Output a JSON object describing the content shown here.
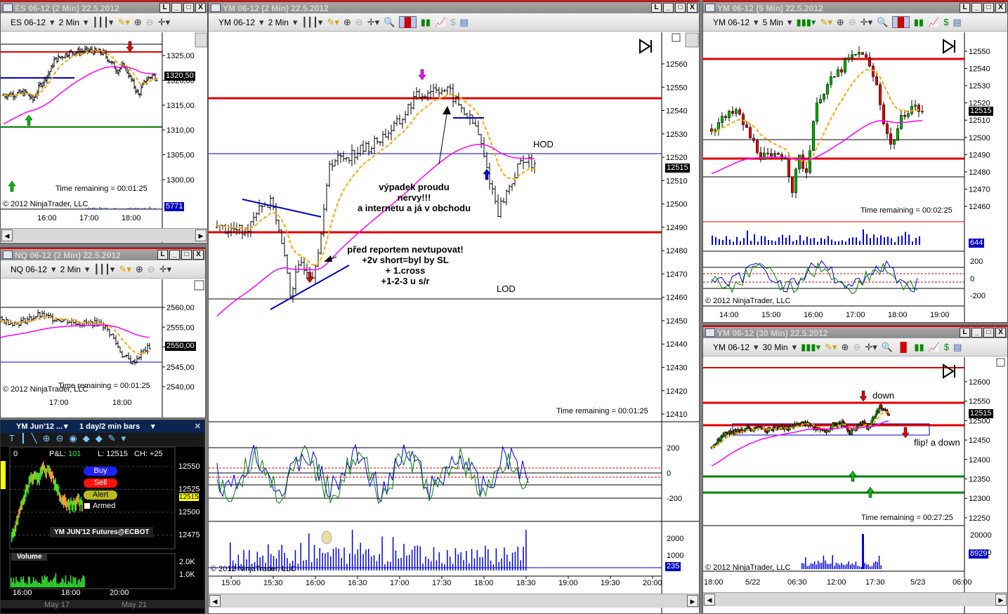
{
  "es": {
    "title": "ES 06-12 (2 Min)  22.5.2012",
    "instrument": "ES 06-12",
    "interval": "2 Min",
    "prices": [
      "1325,00",
      "1320,00",
      "1315,00",
      "1310,00",
      "1305,00",
      "1300,00"
    ],
    "last": "1320,50",
    "time_remaining": "Time remaining = 00:01:25",
    "copyright": "© 2012 NinjaTrader, LLC",
    "volume_badge": "5771",
    "times": [
      "16:00",
      "17:00",
      "18:00"
    ],
    "bars": [
      [
        "14:58",
        1317
      ],
      [
        "15:30",
        1317.5
      ],
      [
        "15:40",
        1316
      ],
      [
        "15:50",
        1319
      ],
      [
        "16:05",
        1322
      ],
      [
        "16:10",
        1324
      ],
      [
        "16:30",
        1325.5
      ],
      [
        "17:00",
        1326
      ],
      [
        "17:20",
        1325.5
      ],
      [
        "17:40",
        1322
      ],
      [
        "17:50",
        1323
      ],
      [
        "18:00",
        1320
      ],
      [
        "18:10",
        1317
      ],
      [
        "18:20",
        1320
      ],
      [
        "18:30",
        1321
      ],
      [
        "18:36",
        1320.5
      ]
    ]
  },
  "nq": {
    "title": "NQ 06-12 (2 Min)  22.5.2012",
    "instrument": "NQ 06-12",
    "interval": "2 Min",
    "prices": [
      "2560,00",
      "2555,00",
      "2550,00",
      "2545,00",
      "2540,00"
    ],
    "last": "2550,00",
    "time_remaining": "Time remaining = 00:01:25",
    "copyright": "© 2012 NinjaTrader, LLC",
    "times": [
      "17:00",
      "18:00"
    ],
    "bars": [
      [
        "15:38",
        2555
      ],
      [
        "16:00",
        2557
      ],
      [
        "16:20",
        2556
      ],
      [
        "16:40",
        2558
      ],
      [
        "17:00",
        2557
      ],
      [
        "17:20",
        2556
      ],
      [
        "17:40",
        2556
      ],
      [
        "17:50",
        2553
      ],
      [
        "18:00",
        2548
      ],
      [
        "18:10",
        2546
      ],
      [
        "18:20",
        2549
      ],
      [
        "18:26",
        2550
      ]
    ]
  },
  "ib": {
    "symbol": "YM Jun'12 ...",
    "period": "1 day/2 min bars",
    "zero": "0",
    "pnl_label": "P&L:",
    "pnl": "101",
    "last": "L: 12515",
    "change": "CH: +25",
    "buy": "Buy",
    "sell": "Sell",
    "alert": "Alert",
    "armed": "Armed",
    "contract": "YM JUN'12 Futures@ECBOT",
    "prices": [
      "12550",
      "12525",
      "12500",
      "12475"
    ],
    "last_badge": "12515",
    "volume": "Volume",
    "vol_ticks": [
      "2.0K",
      "1.0K"
    ],
    "times": [
      "16:00",
      "18:00",
      "20:00"
    ],
    "dates": [
      "May 17",
      "May 21"
    ]
  },
  "main": {
    "title": "YM 06-12 (2 Min)  22.5.2012",
    "instrument": "YM 06-12",
    "interval": "2 Min",
    "prices": [
      "12560",
      "12550",
      "12540",
      "12530",
      "12520",
      "12510",
      "12500",
      "12490",
      "12480",
      "12470",
      "12460",
      "12450",
      "12440",
      "12430",
      "12420",
      "12410"
    ],
    "last": "12515",
    "hod": "HOD",
    "lod": "LOD",
    "note1": [
      "výpadek proudu",
      "nervy!!!",
      "a internetu a já v obchodu"
    ],
    "note2": [
      "před reportem nevtupovat!",
      "+2v short=byl by SL",
      "+ 1.cross",
      "+1-2-3 u s/r"
    ],
    "time_remaining": "Time remaining = 00:01:25",
    "ind_ticks": [
      "200",
      "0",
      "-200"
    ],
    "vol_ticks": [
      "2000",
      "1000"
    ],
    "vol_badge": "235",
    "copyright": "© 2012 NinjaTrader, LLC",
    "times": [
      "15:00",
      "15:30",
      "16:00",
      "16:30",
      "17:00",
      "17:30",
      "18:00",
      "18:30",
      "19:00",
      "19:30",
      "20:00"
    ],
    "bars": [
      [
        "14:50",
        12490
      ],
      [
        "15:10",
        12488
      ],
      [
        "15:20",
        12500
      ],
      [
        "15:30",
        12500
      ],
      [
        "15:40",
        12470
      ],
      [
        "15:42",
        12462
      ],
      [
        "15:50",
        12475
      ],
      [
        "15:58",
        12470
      ],
      [
        "16:05",
        12490
      ],
      [
        "16:10",
        12518
      ],
      [
        "16:20",
        12520
      ],
      [
        "16:40",
        12525
      ],
      [
        "17:00",
        12535
      ],
      [
        "17:10",
        12545
      ],
      [
        "17:25",
        12550
      ],
      [
        "17:35",
        12548
      ],
      [
        "17:45",
        12540
      ],
      [
        "17:55",
        12532
      ],
      [
        "18:02",
        12515
      ],
      [
        "18:10",
        12497
      ],
      [
        "18:20",
        12510
      ],
      [
        "18:28",
        12520
      ],
      [
        "18:36",
        12515
      ]
    ]
  },
  "ym5": {
    "title": "YM 06-12 (5 Min)  22.5.2012",
    "instrument": "YM 06-12",
    "interval": "5 Min",
    "prices": [
      "12550",
      "12540",
      "12530",
      "12520",
      "12510",
      "12500",
      "12490",
      "12480",
      "12470",
      "12460"
    ],
    "last": "12515",
    "time_remaining": "Time remaining = 00:02:25",
    "vol_badge": "644",
    "ind_ticks": [
      "200",
      "0",
      "-200"
    ],
    "copyright": "© 2012 NinjaTrader, LLC",
    "times": [
      "14:00",
      "15:00",
      "16:00",
      "17:00",
      "18:00",
      "19:00"
    ],
    "bars": [
      [
        "13:35",
        12505
      ],
      [
        "13:50",
        12510
      ],
      [
        "14:10",
        12515
      ],
      [
        "14:20",
        12508
      ],
      [
        "14:30",
        12500
      ],
      [
        "14:45",
        12490
      ],
      [
        "15:00",
        12487
      ],
      [
        "15:10",
        12490
      ],
      [
        "15:20",
        12490
      ],
      [
        "15:30",
        12470
      ],
      [
        "15:40",
        12488
      ],
      [
        "15:50",
        12480
      ],
      [
        "16:00",
        12510
      ],
      [
        "16:10",
        12525
      ],
      [
        "16:30",
        12535
      ],
      [
        "16:50",
        12545
      ],
      [
        "17:10",
        12550
      ],
      [
        "17:20",
        12540
      ],
      [
        "17:30",
        12530
      ],
      [
        "17:40",
        12510
      ],
      [
        "17:50",
        12495
      ],
      [
        "18:00",
        12505
      ],
      [
        "18:10",
        12515
      ],
      [
        "18:20",
        12518
      ],
      [
        "18:35",
        12515
      ]
    ]
  },
  "ym30": {
    "title": "YM 06-12 (30 Min)  22.5.2012",
    "instrument": "YM 06-12",
    "interval": "30 Min",
    "prices": [
      "12600",
      "12550",
      "12500",
      "12450",
      "12400",
      "12350",
      "12300",
      "12250"
    ],
    "last": "12515",
    "down": "down",
    "flip": "flip! a down",
    "time_remaining": "Time remaining = 00:27:25",
    "vol_ticks": [
      "20000",
      "10000"
    ],
    "vol_badge": "8929",
    "copyright": "© 2012 NinjaTrader, LLC",
    "times": [
      "18:00",
      "5/22",
      "06:30",
      "12:00",
      "17:30",
      "5/23",
      "06:00"
    ],
    "bars": [
      12430,
      12440,
      12455,
      12465,
      12470,
      12468,
      12472,
      12478,
      12480,
      12475,
      12478,
      12482,
      12480,
      12476,
      12478,
      12480,
      12484,
      12482,
      12480,
      12485,
      12490,
      12492,
      12495,
      12490,
      12485,
      12480,
      12475,
      12470,
      12478,
      12490,
      12488,
      12492,
      12478,
      12470,
      12480,
      12490,
      12495,
      12480,
      12500,
      12520,
      12535,
      12530,
      12515
    ]
  },
  "colors": {
    "up": "#00c000",
    "down": "#e00000",
    "support": "#e00000",
    "ema": "#ffa500",
    "sma": "#ff00ff"
  }
}
